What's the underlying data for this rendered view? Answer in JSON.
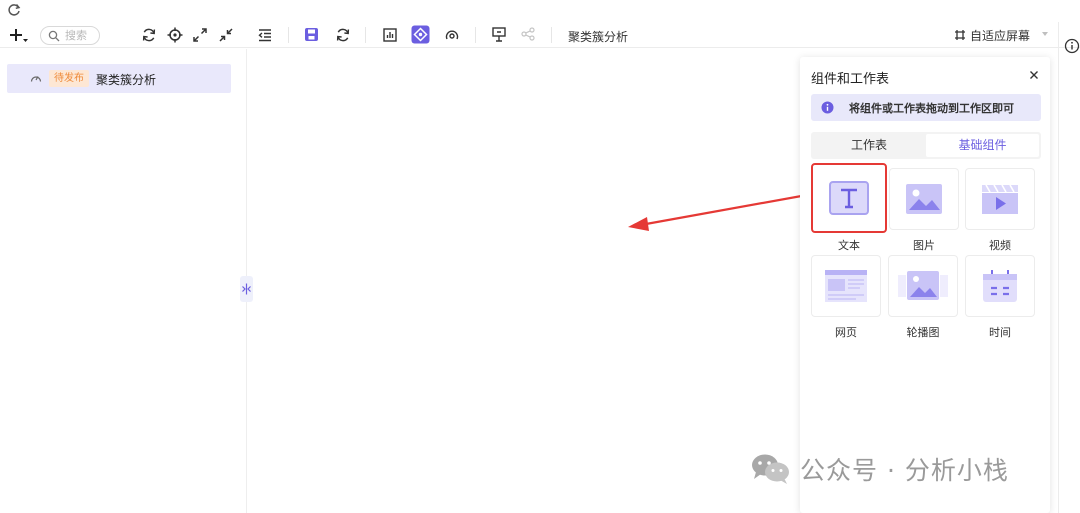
{
  "search": {
    "placeholder": "搜索"
  },
  "toolbar": {
    "title": "聚类簇分析",
    "adapt_label": "自适应屏幕"
  },
  "sidebar": {
    "items": [
      {
        "badge": "待发布",
        "label": "聚类簇分析"
      }
    ]
  },
  "panel": {
    "title": "组件和工作表",
    "hint": "将组件或工作表拖动到工作区即可",
    "tabs": [
      {
        "label": "工作表",
        "active": false
      },
      {
        "label": "基础组件",
        "active": true
      }
    ],
    "components": [
      {
        "label": "文本",
        "icon": "text-icon",
        "selected": true
      },
      {
        "label": "图片",
        "icon": "image-icon",
        "selected": false
      },
      {
        "label": "视频",
        "icon": "video-icon",
        "selected": false
      },
      {
        "label": "网页",
        "icon": "webpage-icon",
        "selected": false
      },
      {
        "label": "轮播图",
        "icon": "carousel-icon",
        "selected": false
      },
      {
        "label": "时间",
        "icon": "calendar-icon",
        "selected": false
      }
    ]
  },
  "watermark": {
    "text": "公众号 · 分析小栈"
  },
  "colors": {
    "accent": "#6b5ee0",
    "accent_light": "#a9a3f0",
    "selected_border": "#e53935",
    "badge_bg": "#fde7d4",
    "badge_text": "#ef8b3a",
    "arrow": "#e53935"
  }
}
